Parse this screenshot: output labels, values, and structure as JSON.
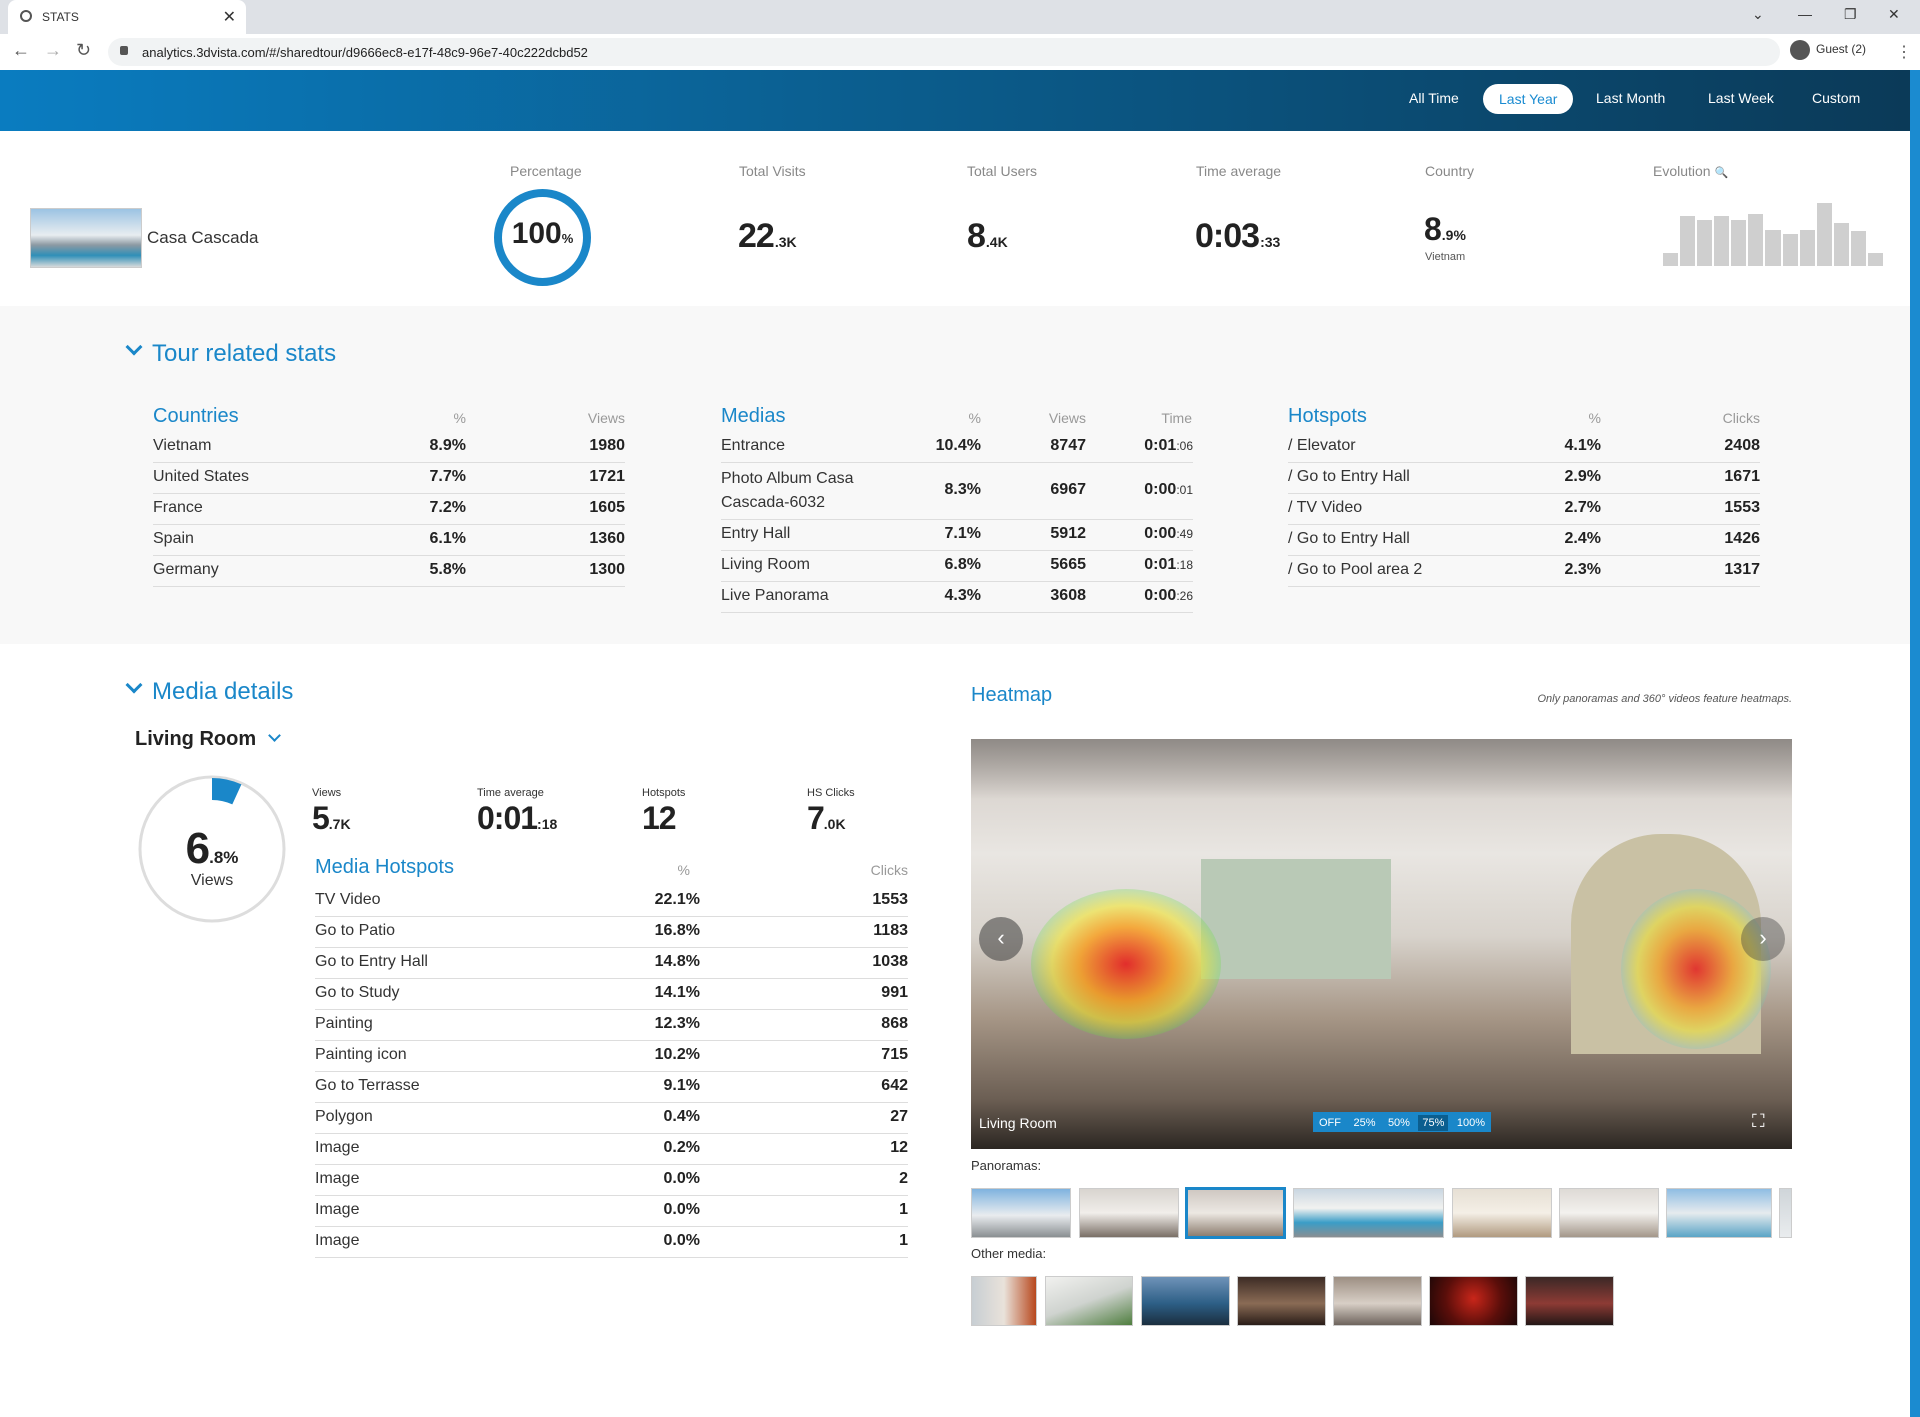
{
  "browser": {
    "tab_title": "STATS",
    "url": "analytics.3dvista.com/#/sharedtour/d9666ec8-e17f-48c9-96e7-40c222dcbd52",
    "profile": "Guest (2)"
  },
  "periods": [
    "All Time",
    "Last Year",
    "Last Month",
    "Last Week",
    "Custom"
  ],
  "active_period": "Last Year",
  "summary": {
    "tour_name": "Casa Cascada",
    "percentage_label": "Percentage",
    "percentage_value": "100",
    "percentage_unit": "%",
    "visits_label": "Total Visits",
    "visits_main": "22",
    "visits_suffix": ".3K",
    "users_label": "Total Users",
    "users_main": "8",
    "users_suffix": ".4K",
    "time_label": "Time average",
    "time_main": "0:03",
    "time_suffix": ":33",
    "country_label": "Country",
    "country_main": "8",
    "country_suffix": ".9%",
    "country_name": "Vietnam",
    "evolution_label": "Evolution"
  },
  "evolution_bars": [
    0.18,
    0.72,
    0.66,
    0.72,
    0.66,
    0.74,
    0.52,
    0.46,
    0.52,
    0.9,
    0.62,
    0.5,
    0.18
  ],
  "tour_stats": {
    "title": "Tour related stats",
    "countries": {
      "title": "Countries",
      "col_pct": "%",
      "col_views": "Views",
      "rows": [
        {
          "name": "Vietnam",
          "pct": "8.9%",
          "views": "1980"
        },
        {
          "name": "United States",
          "pct": "7.7%",
          "views": "1721"
        },
        {
          "name": "France",
          "pct": "7.2%",
          "views": "1605"
        },
        {
          "name": "Spain",
          "pct": "6.1%",
          "views": "1360"
        },
        {
          "name": "Germany",
          "pct": "5.8%",
          "views": "1300"
        }
      ]
    },
    "medias": {
      "title": "Medias",
      "col_pct": "%",
      "col_views": "Views",
      "col_time": "Time",
      "rows": [
        {
          "name": "Entrance",
          "pct": "10.4%",
          "views": "8747",
          "time_main": "0:01",
          "time_sec": ":06"
        },
        {
          "name": "Photo Album Casa",
          "name2": "Cascada-6032",
          "pct": "8.3%",
          "views": "6967",
          "time_main": "0:00",
          "time_sec": ":01"
        },
        {
          "name": "Entry Hall",
          "pct": "7.1%",
          "views": "5912",
          "time_main": "0:00",
          "time_sec": ":49"
        },
        {
          "name": "Living Room",
          "pct": "6.8%",
          "views": "5665",
          "time_main": "0:01",
          "time_sec": ":18"
        },
        {
          "name": "Live Panorama",
          "pct": "4.3%",
          "views": "3608",
          "time_main": "0:00",
          "time_sec": ":26"
        }
      ]
    },
    "hotspots": {
      "title": "Hotspots",
      "col_pct": "%",
      "col_clicks": "Clicks",
      "rows": [
        {
          "name": "/ Elevator",
          "pct": "4.1%",
          "clicks": "2408"
        },
        {
          "name": "/ Go to Entry Hall",
          "pct": "2.9%",
          "clicks": "1671"
        },
        {
          "name": "/ TV Video",
          "pct": "2.7%",
          "clicks": "1553"
        },
        {
          "name": "/ Go to Entry Hall",
          "pct": "2.4%",
          "clicks": "1426"
        },
        {
          "name": "/ Go to Pool area 2",
          "pct": "2.3%",
          "clicks": "1317"
        }
      ]
    }
  },
  "media_details": {
    "title": "Media details",
    "selected_media": "Living Room",
    "views_pct_main": "6",
    "views_pct_suffix": ".8%",
    "views_pct_fraction": 0.068,
    "views_word": "Views",
    "stats": [
      {
        "label": "Views",
        "main": "5",
        "suffix": ".7K"
      },
      {
        "label": "Time average",
        "main": "0:01",
        "suffix": ":18"
      },
      {
        "label": "Hotspots",
        "main": "12",
        "suffix": ""
      },
      {
        "label": "HS Clicks",
        "main": "7",
        "suffix": ".0K"
      }
    ],
    "hotspots": {
      "title": "Media Hotspots",
      "col_pct": "%",
      "col_clicks": "Clicks",
      "rows": [
        {
          "name": "TV Video",
          "pct": "22.1%",
          "clicks": "1553"
        },
        {
          "name": "Go to Patio",
          "pct": "16.8%",
          "clicks": "1183"
        },
        {
          "name": "Go to Entry Hall",
          "pct": "14.8%",
          "clicks": "1038"
        },
        {
          "name": "Go to Study",
          "pct": "14.1%",
          "clicks": "991"
        },
        {
          "name": "Painting",
          "pct": "12.3%",
          "clicks": "868"
        },
        {
          "name": "Painting icon",
          "pct": "10.2%",
          "clicks": "715"
        },
        {
          "name": "Go to Terrasse",
          "pct": "9.1%",
          "clicks": "642"
        },
        {
          "name": "Polygon",
          "pct": "0.4%",
          "clicks": "27"
        },
        {
          "name": "Image",
          "pct": "0.2%",
          "clicks": "12"
        },
        {
          "name": "Image",
          "pct": "0.0%",
          "clicks": "2"
        },
        {
          "name": "Image",
          "pct": "0.0%",
          "clicks": "1"
        },
        {
          "name": "Image",
          "pct": "0.0%",
          "clicks": "1"
        }
      ]
    }
  },
  "heatmap": {
    "title": "Heatmap",
    "note": "Only panoramas and 360° videos feature heatmaps.",
    "pano_label": "Living Room",
    "levels": [
      "OFF",
      "25%",
      "50%",
      "75%",
      "100%"
    ],
    "panoramas_label": "Panoramas:",
    "other_media_label": "Other media:"
  },
  "colors": {
    "accent": "#1a87c9",
    "header_start": "#0a7cc0",
    "header_end": "#0b3a58"
  }
}
